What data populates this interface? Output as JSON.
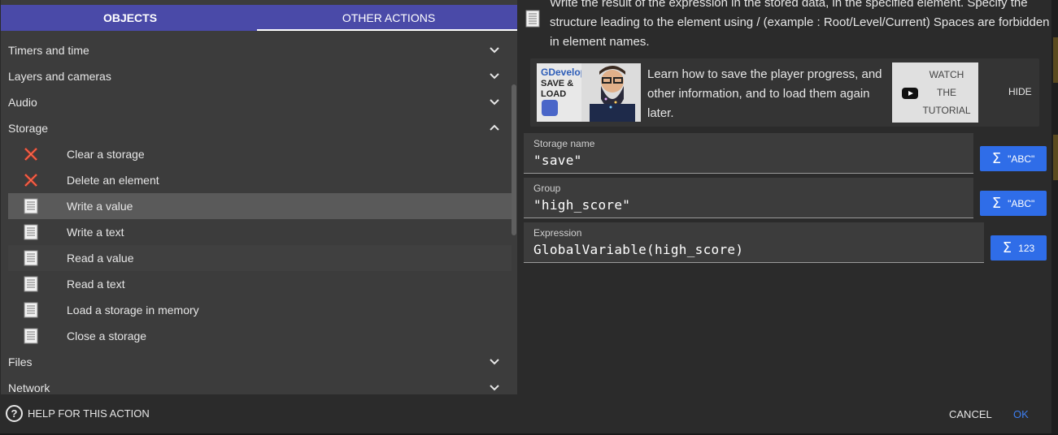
{
  "tabs": {
    "objects": "OBJECTS",
    "other_actions": "OTHER ACTIONS"
  },
  "categories": {
    "timers": "Timers and time",
    "layers": "Layers and cameras",
    "audio": "Audio",
    "storage": "Storage",
    "files": "Files",
    "network": "Network"
  },
  "storage_items": [
    {
      "label": "Clear a storage",
      "icon": "red-x-icon"
    },
    {
      "label": "Delete an element",
      "icon": "red-x-icon"
    },
    {
      "label": "Write a value",
      "icon": "document-icon",
      "selected": true
    },
    {
      "label": "Write a text",
      "icon": "document-icon"
    },
    {
      "label": "Read a value",
      "icon": "document-icon"
    },
    {
      "label": "Read a text",
      "icon": "document-icon"
    },
    {
      "label": "Load a storage in memory",
      "icon": "document-icon"
    },
    {
      "label": "Close a storage",
      "icon": "document-icon"
    }
  ],
  "description": "Write the result of the expression in the stored data, in the specified element. Specify the structure leading to the element using / (example : Root/Level/Current) Spaces are forbidden in element names.",
  "tutorial": {
    "thumb_title": "GDevelop",
    "thumb_subtitle": "SAVE & LOAD",
    "text": "Learn how to save the player progress, and other information, and to load them again later.",
    "watch_label": "WATCH THE TUTORIAL",
    "hide_label": "HIDE"
  },
  "fields": {
    "storage_name": {
      "label": "Storage name",
      "value": "\"save\"",
      "button": "\"ABC\""
    },
    "group": {
      "label": "Group",
      "value": "\"high_score\"",
      "button": "\"ABC\""
    },
    "expression": {
      "label": "Expression",
      "value": "GlobalVariable(high_score)",
      "button": "123"
    }
  },
  "footer": {
    "help": "HELP FOR THIS ACTION",
    "cancel": "CANCEL",
    "ok": "OK"
  },
  "colors": {
    "tab_bar": "#4a4aa8",
    "accent_blue": "#2f6de8",
    "ok_blue": "#3d7ef0"
  }
}
